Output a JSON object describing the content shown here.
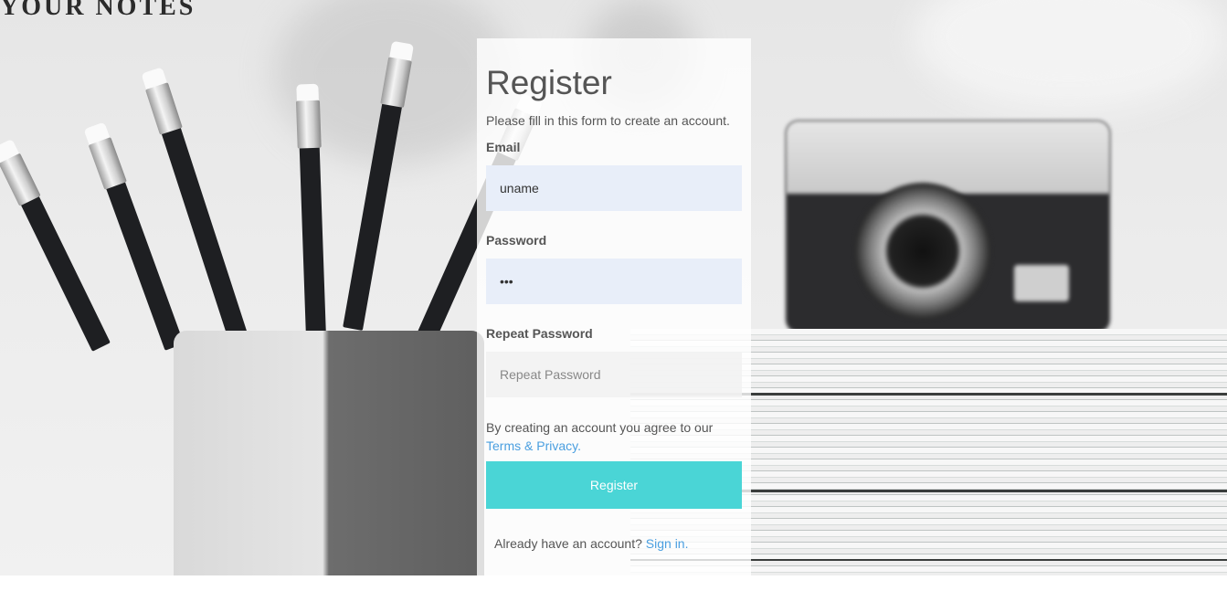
{
  "brand": {
    "title": "YOUR NOTES"
  },
  "form": {
    "heading": "Register",
    "subtitle": "Please fill in this form to create an account.",
    "email": {
      "label": "Email",
      "value": "uname"
    },
    "password": {
      "label": "Password",
      "value": "•••"
    },
    "repeat_password": {
      "label": "Repeat Password",
      "placeholder": "Repeat Password",
      "value": ""
    },
    "terms_text": "By creating an account you agree to our",
    "terms_link": "Terms & Privacy",
    "terms_suffix": ".",
    "submit_label": "Register",
    "signin_text": "Already have an account?",
    "signin_link": "Sign in",
    "signin_suffix": "."
  },
  "colors": {
    "button": "#4ad5d6",
    "link": "#4a9fe0",
    "filled_input": "#e8eef9"
  },
  "icons": {
    "background": "background-photo"
  }
}
